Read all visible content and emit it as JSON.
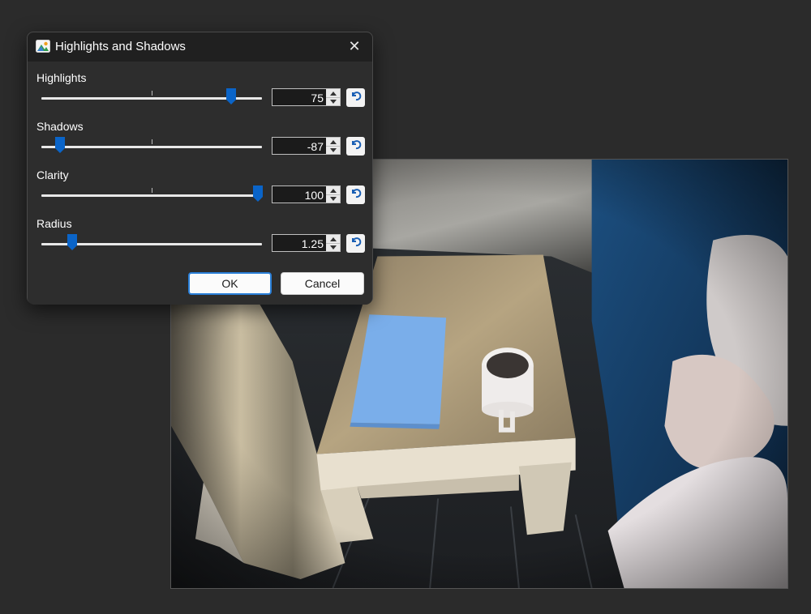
{
  "dialog": {
    "title": "Highlights and Shadows",
    "app_icon": "image-edit-icon",
    "close_icon": "close-icon",
    "close_glyph": "✕",
    "sliders": [
      {
        "label": "Highlights",
        "value": "75",
        "position": 0.86
      },
      {
        "label": "Shadows",
        "value": "-87",
        "position": 0.085
      },
      {
        "label": "Clarity",
        "value": "100",
        "position": 0.98
      },
      {
        "label": "Radius",
        "value": "1.25",
        "position": 0.14
      }
    ],
    "ok_label": "OK",
    "cancel_label": "Cancel"
  },
  "colors": {
    "accent": "#0a64c8",
    "dialog_bg": "#2d2d2d",
    "titlebar_bg": "#202020",
    "page_bg": "#2b2b2b"
  }
}
